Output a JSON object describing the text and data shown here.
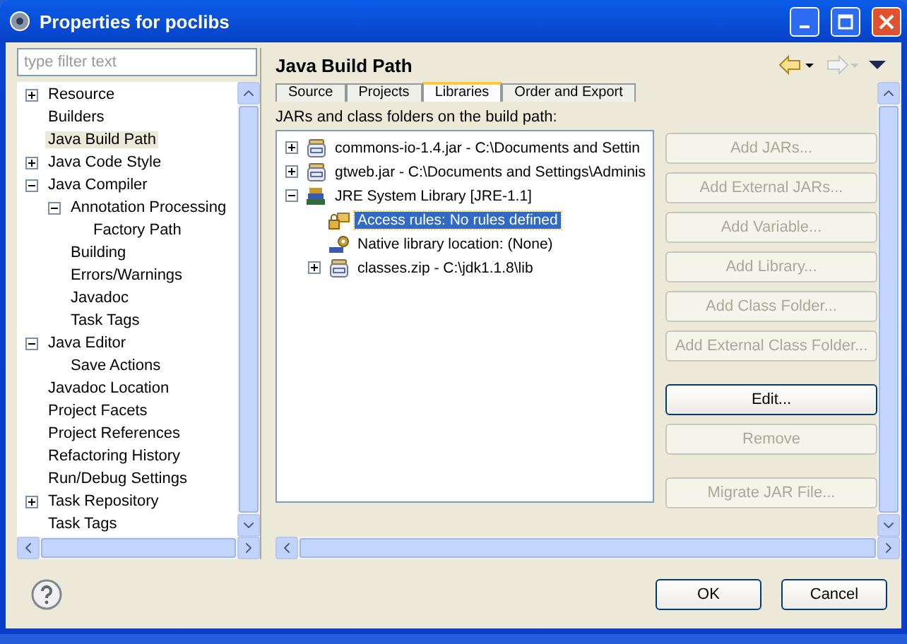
{
  "window": {
    "title": "Properties for poclibs"
  },
  "filter": {
    "placeholder": "type filter text"
  },
  "nav_tree": [
    {
      "label": "Resource",
      "expanded": false,
      "selected": false
    },
    {
      "label": "Builders",
      "selected": false
    },
    {
      "label": "Java Build Path",
      "selected": true
    },
    {
      "label": "Java Code Style",
      "expanded": false,
      "selected": false
    },
    {
      "label": "Java Compiler",
      "expanded": true,
      "selected": false,
      "children": [
        {
          "label": "Annotation Processing",
          "expanded": true,
          "selected": false,
          "children": [
            {
              "label": "Factory Path",
              "selected": false
            }
          ]
        },
        {
          "label": "Building",
          "selected": false
        },
        {
          "label": "Errors/Warnings",
          "selected": false
        },
        {
          "label": "Javadoc",
          "selected": false
        },
        {
          "label": "Task Tags",
          "selected": false
        }
      ]
    },
    {
      "label": "Java Editor",
      "expanded": true,
      "selected": false,
      "children": [
        {
          "label": "Save Actions",
          "selected": false
        }
      ]
    },
    {
      "label": "Javadoc Location",
      "selected": false
    },
    {
      "label": "Project Facets",
      "selected": false
    },
    {
      "label": "Project References",
      "selected": false
    },
    {
      "label": "Refactoring History",
      "selected": false
    },
    {
      "label": "Run/Debug Settings",
      "selected": false
    },
    {
      "label": "Task Repository",
      "expanded": false,
      "selected": false
    },
    {
      "label": "Task Tags",
      "selected": false
    }
  ],
  "page": {
    "title": "Java Build Path",
    "tabs": [
      {
        "label": "Source",
        "selected": false
      },
      {
        "label": "Projects",
        "selected": false
      },
      {
        "label": "Libraries",
        "selected": true
      },
      {
        "label": "Order and Export",
        "selected": false
      }
    ],
    "list_label": "JARs and class folders on the build path:",
    "entries": [
      {
        "kind": "jar",
        "label": "commons-io-1.4.jar - C:\\Documents and Settin",
        "expanded": false,
        "selected": false
      },
      {
        "kind": "jar",
        "label": "gtweb.jar - C:\\Documents and Settings\\Adminis",
        "expanded": false,
        "selected": false
      },
      {
        "kind": "jre",
        "label": "JRE System Library [JRE-1.1]",
        "expanded": true,
        "selected": false,
        "children": [
          {
            "kind": "access",
            "label": "Access rules: No rules defined",
            "selected": true
          },
          {
            "kind": "native",
            "label": "Native library location: (None)",
            "selected": false
          },
          {
            "kind": "jar",
            "label": "classes.zip - C:\\jdk1.1.8\\lib",
            "expanded": false,
            "selected": false
          }
        ]
      }
    ],
    "button_groups": [
      [
        {
          "label": "Add JARs...",
          "disabled": true
        },
        {
          "label": "Add External JARs...",
          "disabled": true
        },
        {
          "label": "Add Variable...",
          "disabled": true
        },
        {
          "label": "Add Library...",
          "disabled": true
        },
        {
          "label": "Add Class Folder...",
          "disabled": true
        },
        {
          "label": "Add External Class Folder...",
          "disabled": true
        }
      ],
      [
        {
          "label": "Edit...",
          "disabled": false
        },
        {
          "label": "Remove",
          "disabled": true
        }
      ],
      [
        {
          "label": "Migrate JAR File...",
          "disabled": true
        }
      ]
    ]
  },
  "dialog_buttons": [
    "OK",
    "Cancel"
  ]
}
